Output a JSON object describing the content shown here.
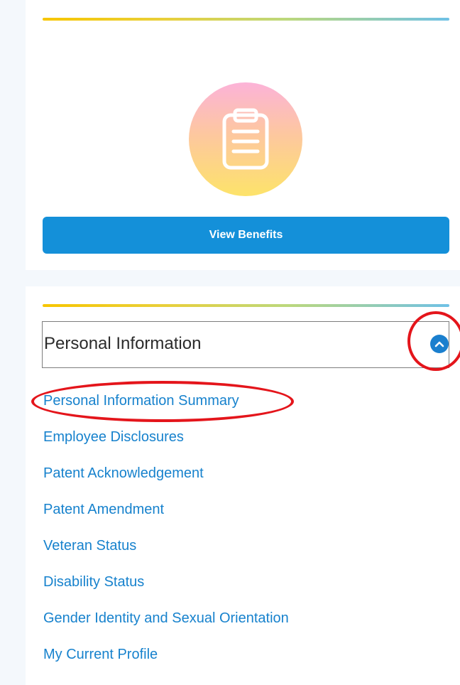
{
  "benefits_card": {
    "icon": "clipboard-icon",
    "view_benefits_label": "View Benefits"
  },
  "personal_information": {
    "title": "Personal Information",
    "toggle_icon": "chevron-up-icon",
    "expanded": true,
    "links": [
      {
        "label": "Personal Information Summary"
      },
      {
        "label": "Employee Disclosures"
      },
      {
        "label": "Patent Acknowledgement"
      },
      {
        "label": "Patent Amendment"
      },
      {
        "label": "Veteran Status"
      },
      {
        "label": "Disability Status"
      },
      {
        "label": "Gender Identity and Sexual Orientation"
      },
      {
        "label": "My Current Profile"
      }
    ]
  },
  "colors": {
    "button_blue": "#1490d9",
    "link_blue": "#1782cd",
    "annotation_red": "#e4151b",
    "icon_gradient_top": "#fcb3d8",
    "icon_gradient_bottom": "#fde36a"
  }
}
